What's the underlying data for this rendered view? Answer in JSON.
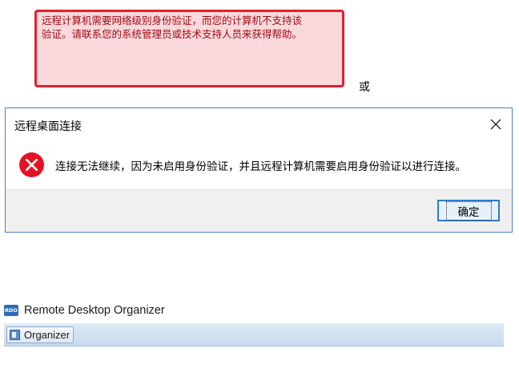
{
  "notice": {
    "text": "远程计算机需要网络级别身份验证，而您的计算机不支持该\n验证。请联系您的系统管理员或技术支持人员来获得帮助。"
  },
  "or_text": "或",
  "dialog": {
    "title": "远程桌面连接",
    "close_icon": "close-icon",
    "error_icon": "error-x-icon",
    "message": "连接无法继续，因为未启用身份验证，并且远程计算机需要启用身份验证以进行连接。",
    "ok_label": "确定"
  },
  "app": {
    "logo_text": "RDO",
    "title": "Remote Desktop Organizer",
    "toolbar": {
      "organizer_label": "Organizer"
    }
  },
  "colors": {
    "notice_border": "#e1202d",
    "notice_background": "#f9d9dc",
    "notice_text": "#a10a15",
    "error_icon": "#e81123",
    "button_border": "#2b7bd0"
  }
}
